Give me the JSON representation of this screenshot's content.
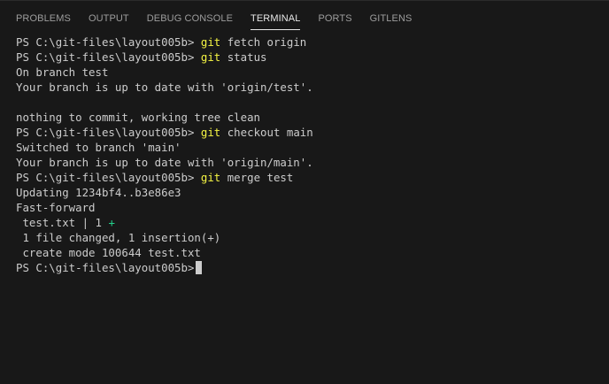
{
  "tabs": [
    {
      "label": "PROBLEMS",
      "active": false
    },
    {
      "label": "OUTPUT",
      "active": false
    },
    {
      "label": "DEBUG CONSOLE",
      "active": false
    },
    {
      "label": "TERMINAL",
      "active": true
    },
    {
      "label": "PORTS",
      "active": false
    },
    {
      "label": "GITLENS",
      "active": false
    }
  ],
  "terminal": {
    "prompt": "PS C:\\git-files\\layout005b>",
    "lines": [
      {
        "kind": "command",
        "cmd": "git",
        "args": " fetch origin"
      },
      {
        "kind": "command",
        "cmd": "git",
        "args": " status"
      },
      {
        "kind": "output",
        "text": "On branch test"
      },
      {
        "kind": "output",
        "text": "Your branch is up to date with 'origin/test'."
      },
      {
        "kind": "output",
        "text": ""
      },
      {
        "kind": "output",
        "text": "nothing to commit, working tree clean"
      },
      {
        "kind": "command",
        "cmd": "git",
        "args": " checkout main"
      },
      {
        "kind": "output",
        "text": "Switched to branch 'main'"
      },
      {
        "kind": "output",
        "text": "Your branch is up to date with 'origin/main'."
      },
      {
        "kind": "command",
        "cmd": "git",
        "args": " merge test"
      },
      {
        "kind": "output",
        "text": "Updating 1234bf4..b3e86e3"
      },
      {
        "kind": "output",
        "text": "Fast-forward"
      },
      {
        "kind": "diffstat",
        "text": " test.txt | 1 ",
        "plus": "+"
      },
      {
        "kind": "output",
        "text": " 1 file changed, 1 insertion(+)"
      },
      {
        "kind": "output",
        "text": " create mode 100644 test.txt"
      },
      {
        "kind": "prompt"
      }
    ]
  },
  "colors": {
    "background": "#181818",
    "command": "#f5f543",
    "diff_plus": "#23d18b",
    "text": "#cccccc"
  }
}
